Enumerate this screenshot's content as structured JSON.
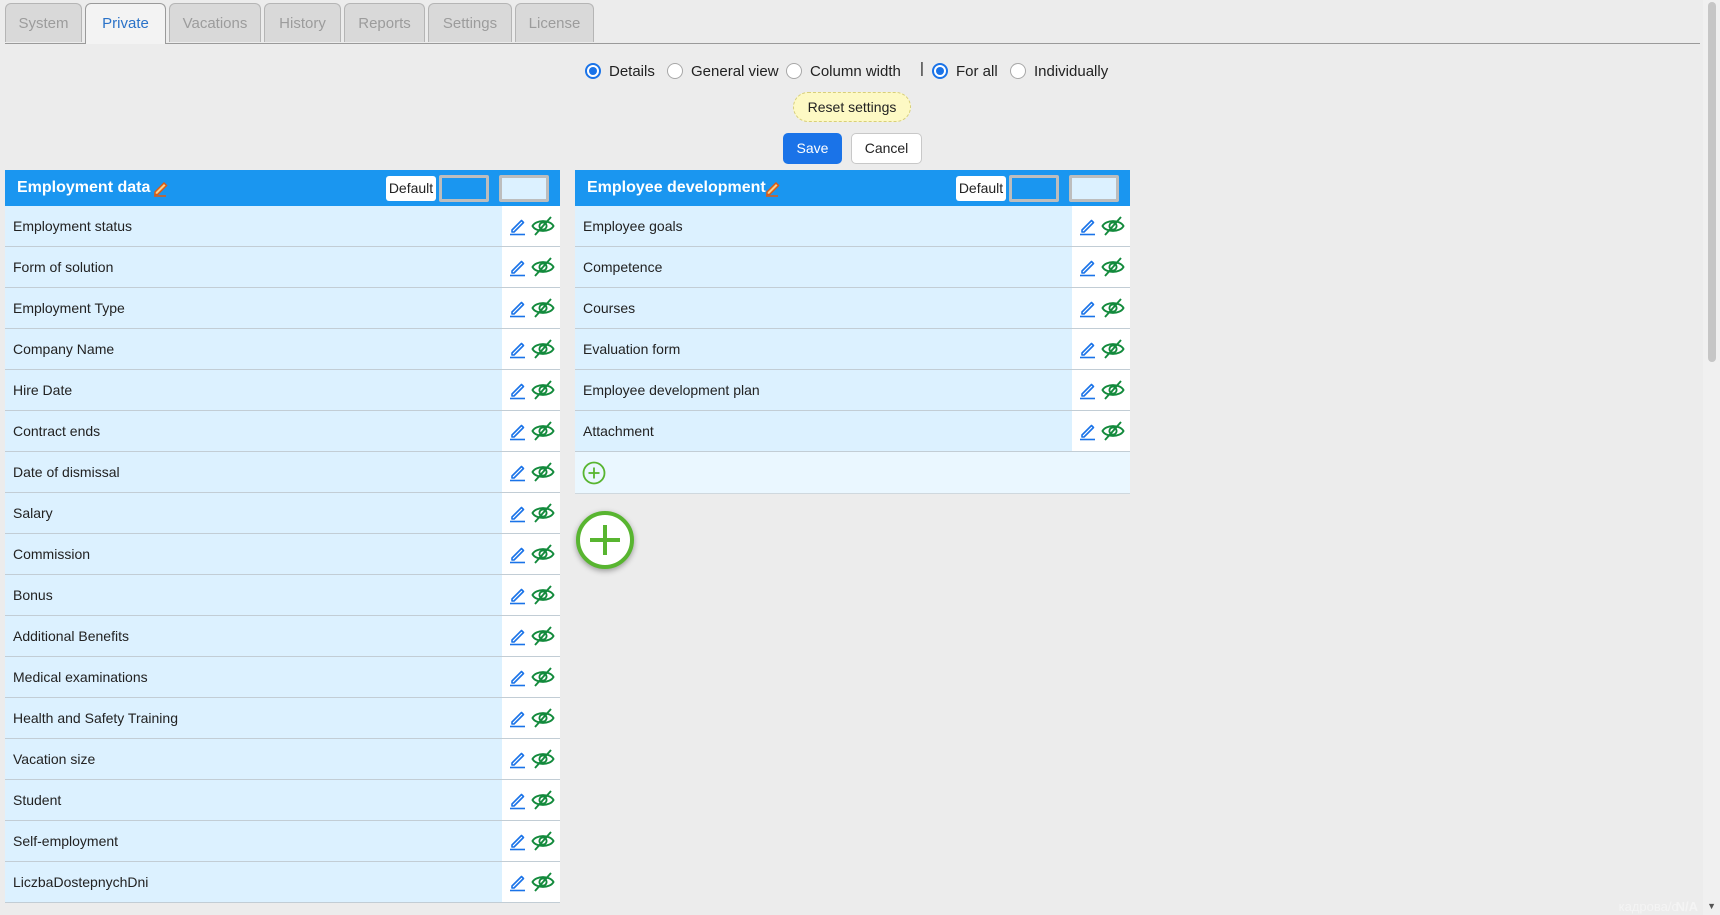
{
  "tabs": [
    {
      "label": "System"
    },
    {
      "label": "Private",
      "active": true
    },
    {
      "label": "Vacations"
    },
    {
      "label": "History"
    },
    {
      "label": "Reports"
    },
    {
      "label": "Settings"
    },
    {
      "label": "License"
    }
  ],
  "options": {
    "view_mode": {
      "details": "Details",
      "general_view": "General view",
      "column_width": "Column width",
      "selected": "Details"
    },
    "separator": "|",
    "scope": {
      "for_all": "For all",
      "individually": "Individually",
      "selected": "For all"
    }
  },
  "buttons": {
    "reset": "Reset settings",
    "save": "Save",
    "cancel": "Cancel"
  },
  "colors": {
    "accent": "#1a73e8",
    "header": "#1a96f0",
    "row_bg": "#dcf1ff",
    "eye_icon": "#138a3c",
    "edit_icon": "#1a73e8",
    "add_icon": "#58b530"
  },
  "panels": {
    "employment": {
      "title": "Employment data",
      "default_label": "Default",
      "header_color_swatch": "#1a96f0",
      "row_color_swatch": "#dcf1ff",
      "items": [
        "Employment status",
        "Form of solution",
        "Employment Type",
        "Company Name",
        "Hire Date",
        "Contract ends",
        "Date of dismissal",
        "Salary",
        "Commission",
        "Bonus",
        "Additional Benefits",
        "Medical examinations",
        "Health and Safety Training",
        "Vacation size",
        "Student",
        "Self-employment",
        "LiczbaDostepnychDni"
      ]
    },
    "development": {
      "title": "Employee development",
      "default_label": "Default",
      "header_color_swatch": "#1a96f0",
      "row_color_swatch": "#dcf1ff",
      "items": [
        "Employee goals",
        "Competence",
        "Courses",
        "Evaluation form",
        "Employee development plan",
        "Attachment"
      ]
    }
  },
  "footer": {
    "brand": "кадрова/с",
    "status": "N/A"
  }
}
